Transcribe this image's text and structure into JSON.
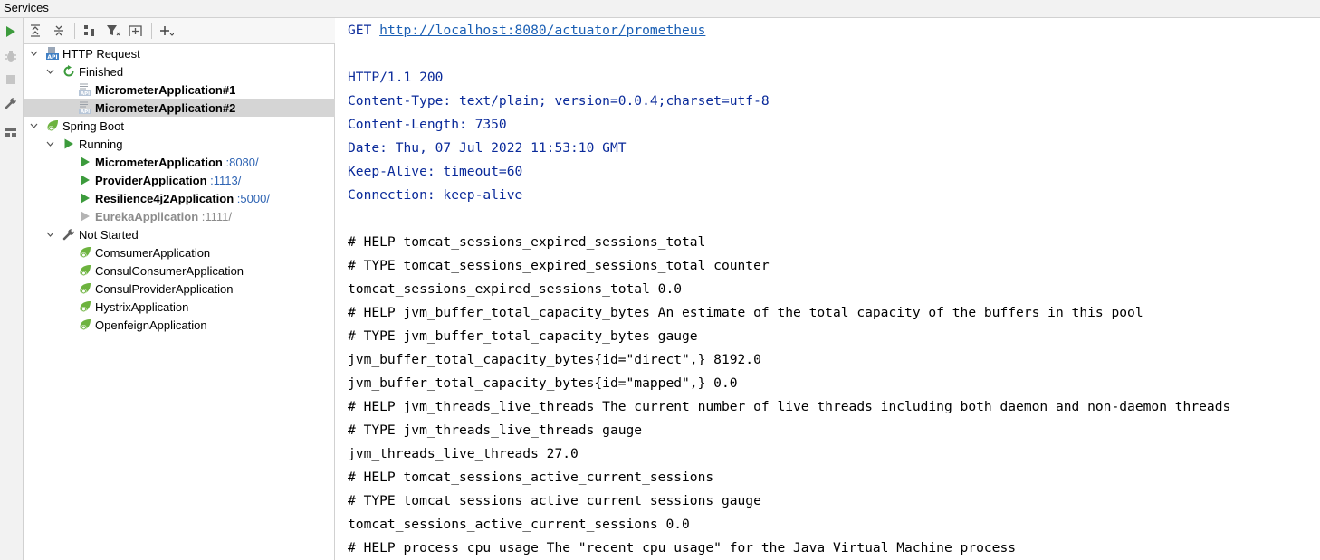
{
  "window": {
    "title": "Services"
  },
  "tree": {
    "http_request": {
      "label": "HTTP Request",
      "finished": {
        "label": "Finished",
        "items": [
          {
            "label": "MicrometerApplication#1"
          },
          {
            "label": "MicrometerApplication#2",
            "selected": true
          }
        ]
      }
    },
    "spring_boot": {
      "label": "Spring Boot",
      "running": {
        "label": "Running",
        "items": [
          {
            "label": "MicrometerApplication",
            "port": ":8080/"
          },
          {
            "label": "ProviderApplication",
            "port": ":1113/"
          },
          {
            "label": "Resilience4j2Application",
            "port": ":5000/"
          },
          {
            "label": "EurekaApplication",
            "port": ":1111/",
            "dimmed": true
          }
        ]
      },
      "not_started": {
        "label": "Not Started",
        "items": [
          {
            "label": "ComsumerApplication"
          },
          {
            "label": "ConsulConsumerApplication"
          },
          {
            "label": "ConsulProviderApplication"
          },
          {
            "label": "HystrixApplication"
          },
          {
            "label": "OpenfeignApplication"
          }
        ]
      }
    }
  },
  "response": {
    "method": "GET",
    "url": "http://localhost:8080/actuator/prometheus",
    "status_line": "HTTP/1.1 200",
    "headers": [
      "Content-Type: text/plain; version=0.0.4;charset=utf-8",
      "Content-Length: 7350",
      "Date: Thu, 07 Jul 2022 11:53:10 GMT",
      "Keep-Alive: timeout=60",
      "Connection: keep-alive"
    ],
    "body": [
      "# HELP tomcat_sessions_expired_sessions_total",
      "# TYPE tomcat_sessions_expired_sessions_total counter",
      "tomcat_sessions_expired_sessions_total 0.0",
      "# HELP jvm_buffer_total_capacity_bytes An estimate of the total capacity of the buffers in this pool",
      "# TYPE jvm_buffer_total_capacity_bytes gauge",
      "jvm_buffer_total_capacity_bytes{id=\"direct\",} 8192.0",
      "jvm_buffer_total_capacity_bytes{id=\"mapped\",} 0.0",
      "# HELP jvm_threads_live_threads The current number of live threads including both daemon and non-daemon threads",
      "# TYPE jvm_threads_live_threads gauge",
      "jvm_threads_live_threads 27.0",
      "# HELP tomcat_sessions_active_current_sessions",
      "# TYPE tomcat_sessions_active_current_sessions gauge",
      "tomcat_sessions_active_current_sessions 0.0",
      "# HELP process_cpu_usage The \"recent cpu usage\" for the Java Virtual Machine process"
    ]
  },
  "colors": {
    "run_green": "#3c9b3c",
    "port_blue": "#2f64b3",
    "header_blue": "#0a2a9a",
    "selection": "#d5d5d5"
  }
}
